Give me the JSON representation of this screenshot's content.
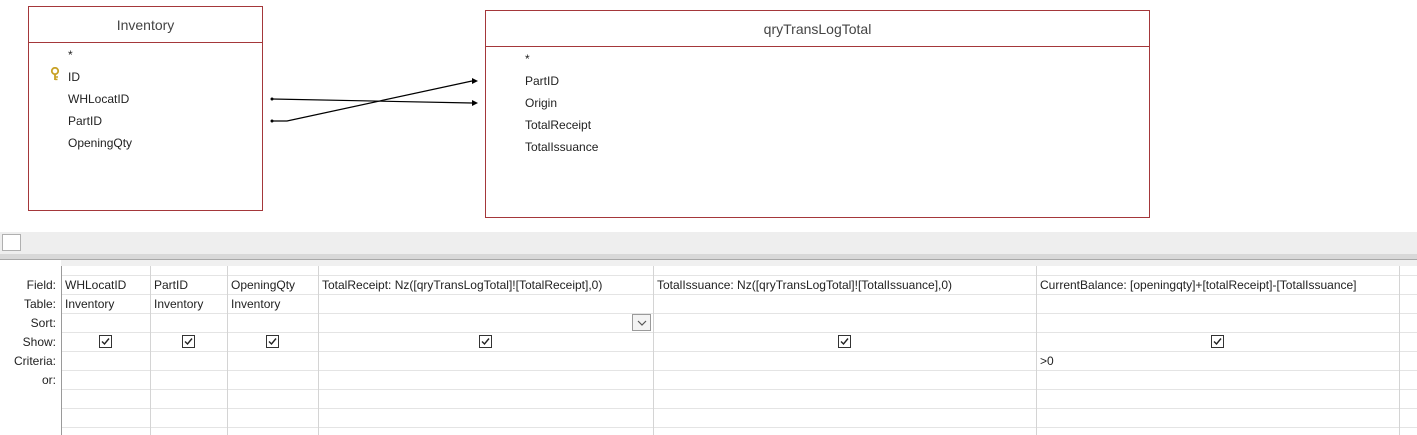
{
  "tables": [
    {
      "name": "Inventory",
      "fields": [
        "*",
        "ID",
        "WHLocatID",
        "PartID",
        "OpeningQty"
      ],
      "primary_key": "ID"
    },
    {
      "name": "qryTransLogTotal",
      "fields": [
        "*",
        "PartID",
        "Origin",
        "TotalReceipt",
        "TotalIssuance"
      ]
    }
  ],
  "joins": [
    {
      "from": "Inventory.WHLocatID",
      "to": "qryTransLogTotal.Origin"
    },
    {
      "from": "Inventory.PartID",
      "to": "qryTransLogTotal.PartID"
    }
  ],
  "grid": {
    "row_labels": [
      "Field:",
      "Table:",
      "Sort:",
      "Show:",
      "Criteria:",
      "or:"
    ],
    "columns": [
      {
        "field": "WHLocatID",
        "table": "Inventory",
        "sort": "",
        "show": true,
        "criteria": ""
      },
      {
        "field": "PartID",
        "table": "Inventory",
        "sort": "",
        "show": true,
        "criteria": ""
      },
      {
        "field": "OpeningQty",
        "table": "Inventory",
        "sort": "",
        "show": true,
        "criteria": ""
      },
      {
        "field": "TotalReceipt: Nz([qryTransLogTotal]![TotalReceipt],0)",
        "table": "",
        "sort": "",
        "show": true,
        "criteria": ""
      },
      {
        "field": "TotalIssuance: Nz([qryTransLogTotal]![TotalIssuance],0)",
        "table": "",
        "sort": "",
        "show": true,
        "criteria": ""
      },
      {
        "field": "CurrentBalance: [openingqty]+[totalReceipt]-[TotalIssuance]",
        "table": "",
        "sort": "",
        "show": true,
        "criteria": ">0"
      }
    ]
  },
  "icons": {
    "primary_key": "key-icon",
    "sort_dropdown": "chevron-down-icon",
    "show": "checkmark-icon"
  },
  "colors": {
    "table_border": "#a4373a",
    "key_icon": "#c9a227"
  }
}
